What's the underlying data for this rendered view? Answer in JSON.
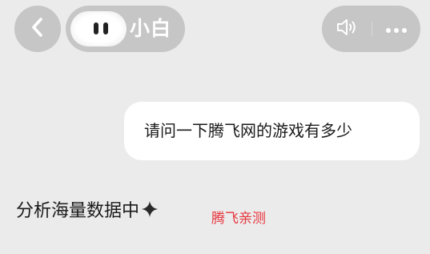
{
  "header": {
    "bot_name": "小白",
    "back_icon": "chevron-left-icon",
    "speaker_icon": "speaker-icon",
    "more_icon": "more-dots-icon"
  },
  "conversation": {
    "user_message": "请问一下腾飞网的游戏有多少",
    "bot_status": "分析海量数据中",
    "status_icon": "sparkle-icon"
  },
  "watermark": {
    "text": "腾飞亲测",
    "color": "#e8353d"
  }
}
